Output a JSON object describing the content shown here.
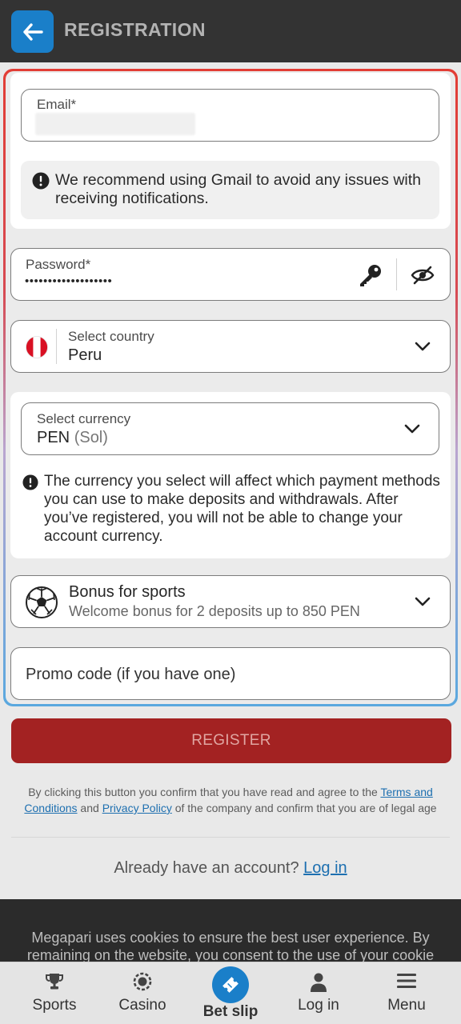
{
  "header": {
    "title": "REGISTRATION"
  },
  "email": {
    "label": "Email*",
    "notice": "We recommend using Gmail to avoid any issues with receiving notifications."
  },
  "password": {
    "label": "Password*",
    "value": "•••••••••••••••••••"
  },
  "country": {
    "label": "Select country",
    "value": "Peru"
  },
  "currency": {
    "label": "Select currency",
    "code": "PEN",
    "name": "(Sol)",
    "notice": "The currency you select will affect which payment methods you can use to make deposits and withdrawals. After you’ve registered, you will not be able to change your account currency."
  },
  "bonus": {
    "title": "Bonus for sports",
    "subtitle": "Welcome bonus for 2 deposits up to 850 PEN"
  },
  "promo": {
    "placeholder": "Promo code (if you have one)"
  },
  "register": {
    "label": "REGISTER"
  },
  "legal": {
    "part1": "By clicking this button you confirm that you have read and agree to the ",
    "terms_link": "Terms and Conditions",
    "part2": " and ",
    "privacy_link": "Privacy Policy",
    "part3": " of the company and confirm that you are of legal age"
  },
  "login": {
    "prompt": "Already have an account? ",
    "link": "Log in"
  },
  "cookie": {
    "text": "Megapari uses cookies to ensure the best user experience. By remaining on the website, you consent to the use of your cookie files"
  },
  "nav": {
    "sports": "Sports",
    "casino": "Casino",
    "betslip": "Bet slip",
    "login": "Log in",
    "menu": "Menu"
  },
  "colors": {
    "header_bg": "#333333",
    "accent_blue": "#1a7fc9",
    "register_red": "#a32222",
    "link_blue": "#1d6fb0"
  }
}
